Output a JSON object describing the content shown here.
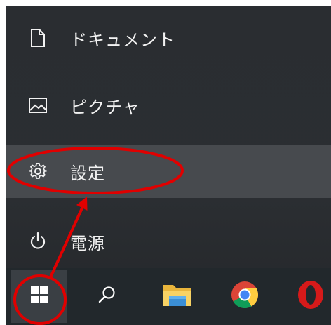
{
  "start_menu": {
    "items": [
      {
        "label": "ドキュメント",
        "icon": "document-icon"
      },
      {
        "label": "ピクチャ",
        "icon": "pictures-icon"
      },
      {
        "label": "設定",
        "icon": "gear-icon",
        "highlighted": true
      },
      {
        "label": "電源",
        "icon": "power-icon"
      }
    ]
  },
  "taskbar": {
    "buttons": [
      {
        "icon": "windows-start-icon"
      },
      {
        "icon": "search-icon"
      },
      {
        "icon": "file-explorer-icon"
      },
      {
        "icon": "chrome-icon"
      },
      {
        "icon": "opera-icon"
      }
    ]
  },
  "annotation": {
    "color": "#e00000",
    "shapes": [
      "ellipse-settings",
      "ellipse-start",
      "arrow"
    ]
  },
  "colors": {
    "menu_bg": "#2b2e32",
    "highlight_bg": "#474a4e",
    "taskbar_bg": "#22282c",
    "text": "#f2f2f2"
  }
}
